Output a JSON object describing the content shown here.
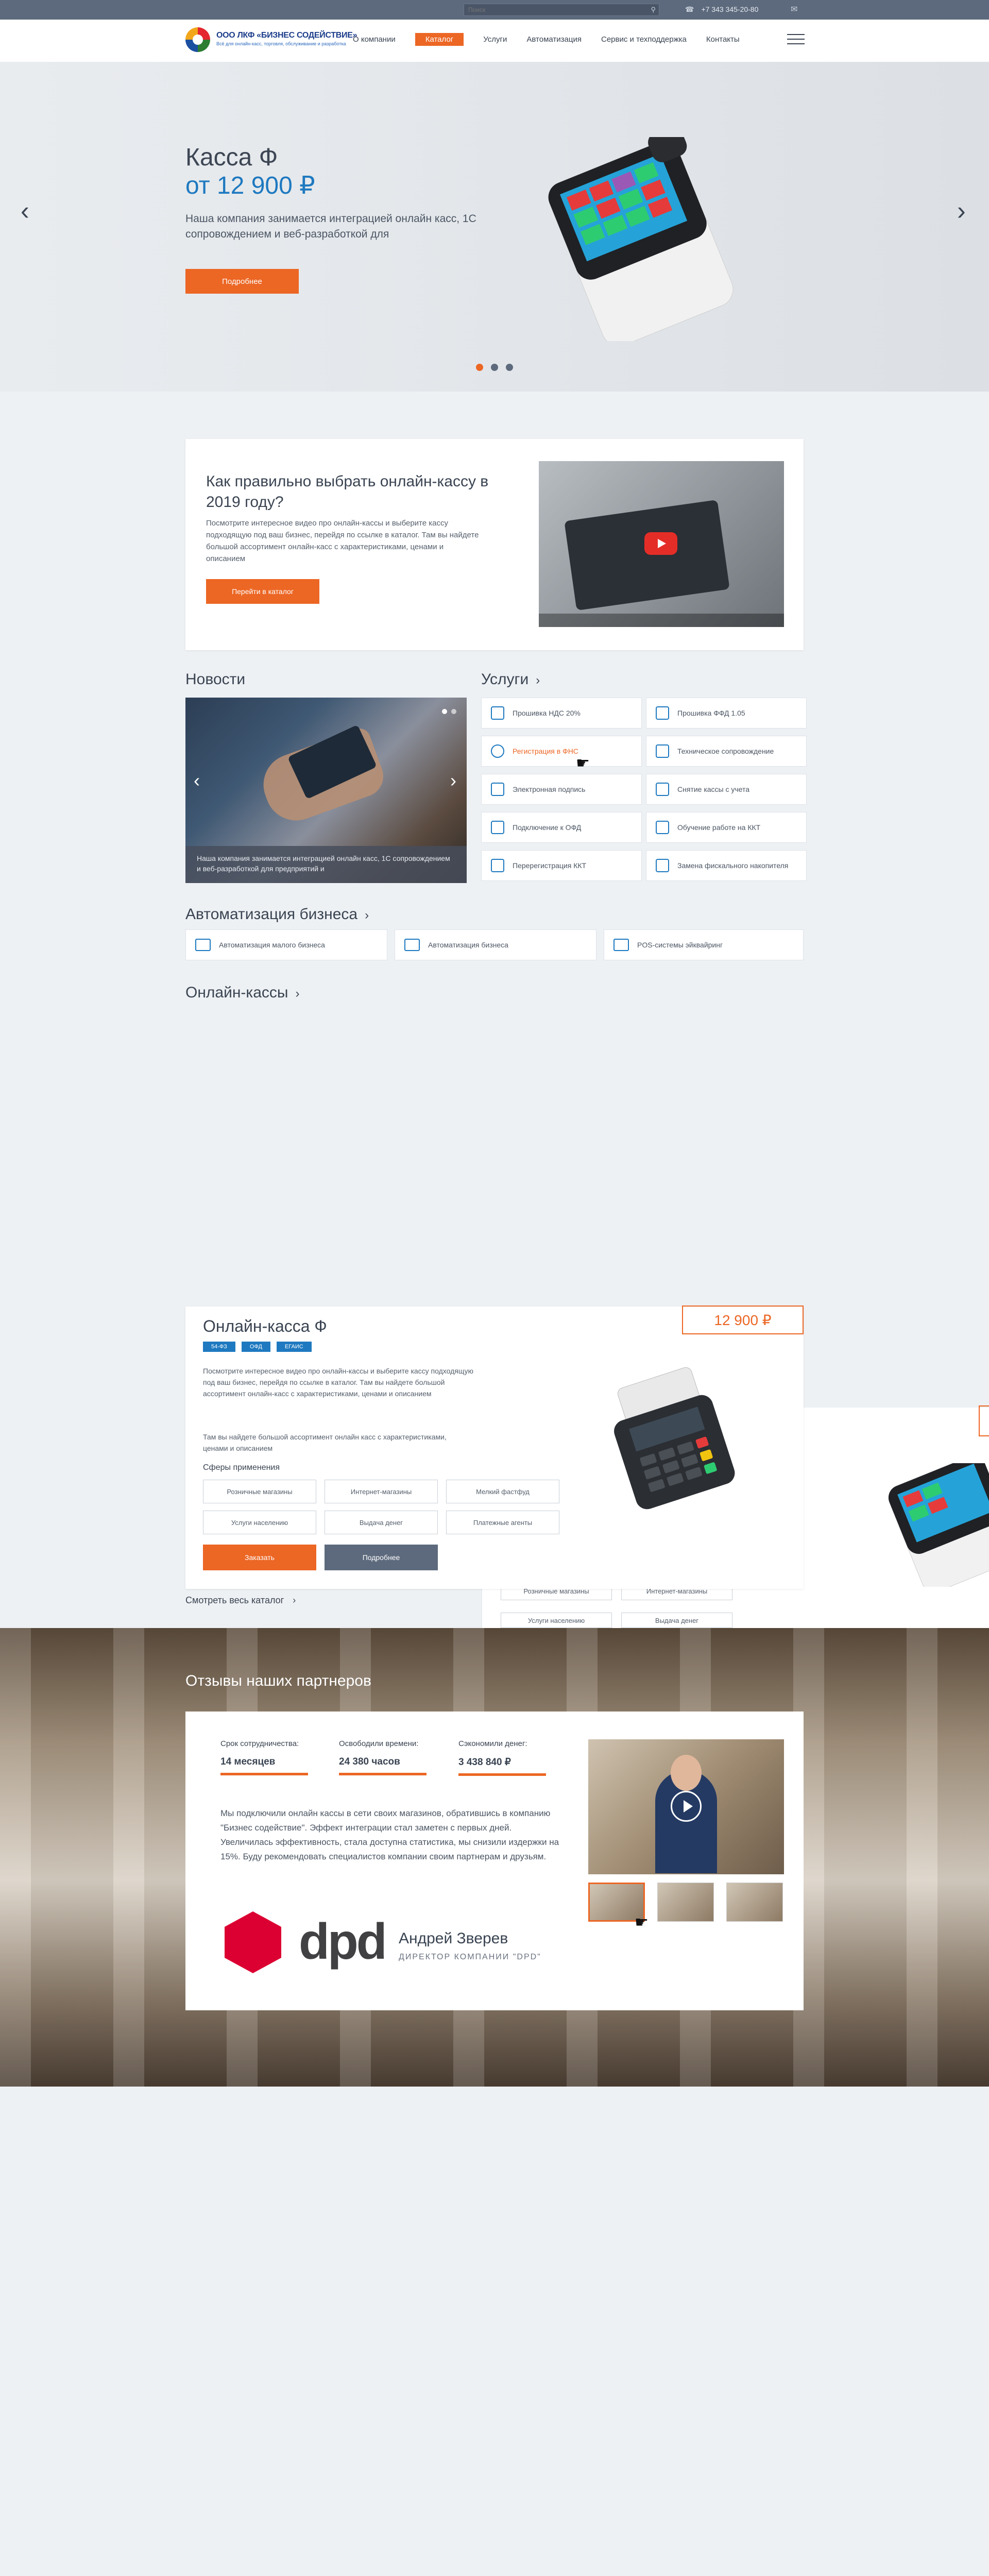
{
  "topbar": {
    "search_placeholder": "Поиск",
    "phone": "+7 343 345-20-80"
  },
  "header": {
    "logo_title": "ООО ЛКФ «БИЗНЕС СОДЕЙСТВИЕ»",
    "logo_sub": "Всё для онлайн-касс, торговля, обслуживание и разработка",
    "nav": [
      "О компании",
      "Каталог",
      "Услуги",
      "Автоматизация",
      "Сервис и техподдержка",
      "Контакты"
    ]
  },
  "hero": {
    "title": "Касса Ф",
    "price": "от 12 900 ₽",
    "desc": "Наша компания занимается интеграцией онлайн касс, 1С сопровождением и веб-разработкой для",
    "button": "Подробнее"
  },
  "promo": {
    "title": "Как правильно выбрать онлайн-кассу в 2019 году?",
    "desc": "Посмотрите интересное видео про онлайн-кассы и выберите кассу подходящую под ваш бизнес, перейдя по ссылке в каталог. Там вы найдете большой ассортимент онлайн-касс с характеристиками, ценами и описанием",
    "button": "Перейти в каталог"
  },
  "news": {
    "heading": "Новости",
    "caption": "Наша компания занимается интеграцией онлайн касс, 1С сопровождением и веб-разработкой для предприятий и"
  },
  "services": {
    "heading": "Услуги",
    "items": [
      "Прошивка НДС 20%",
      "Прошивка ФФД 1.05",
      "Регистрация в ФНС",
      "Техническое сопровождение",
      "Электронная подпись",
      "Снятие кассы с учета",
      "Подключение к ОФД",
      "Обучение работе на ККТ",
      "Перерегистрация ККТ",
      "Замена фискального накопителя"
    ]
  },
  "automation": {
    "heading": "Автоматизация бизнеса",
    "items": [
      "Автоматизация малого бизнеса",
      "Автоматизация бизнеса",
      "POS-системы эйквайринг"
    ]
  },
  "online_kassy": {
    "heading": "Онлайн-кассы"
  },
  "product": {
    "title": "Онлайн-касса Ф",
    "price": "12 900 ₽",
    "tags": [
      "54-ФЗ",
      "ОФД",
      "ЕГАИС"
    ],
    "desc": "Посмотрите интересное видео про онлайн-кассы и выберите кассу подходящую под ваш бизнес, перейдя по ссылке в каталог. Там вы найдете большой ассортимент онлайн-касс с характеристиками, ценами и описанием",
    "desc2": "Там вы найдете большой ассортимент онлайн касс с характеристиками, ценами и описанием",
    "spheres_label": "Сферы применения",
    "spheres": [
      "Розничные магазины",
      "Интернет-магазины",
      "Мелкий фастфуд",
      "Услуги населению",
      "Выдача денег",
      "Платежные агенты"
    ],
    "order_button": "Заказать",
    "more_button": "Подробнее",
    "back_chips": [
      "Розничные магазины",
      "Интернет-магазины",
      "Услуги населению",
      "Выдача денег"
    ]
  },
  "see_all": "Смотреть весь каталог",
  "reviews": {
    "heading": "Отзывы наших партнеров",
    "stats": [
      {
        "label": "Срок сотрудничества:",
        "value": "14 месяцев"
      },
      {
        "label": "Освободили времени:",
        "value": "24 380 часов"
      },
      {
        "label": "Сэкономили денег:",
        "value": "3 438 840 ₽"
      }
    ],
    "text": "Мы подключили онлайн кассы в сети своих магазинов, обратившись в компанию \"Бизнес содействие\". Эффект интеграции стал заметен с первых дней. Увеличилась эффективность, стала доступна статистика, мы снизили издержки на 15%. Буду рекомендовать специалистов компании своим партнерам и друзьям.",
    "brand": "dpd",
    "person": "Андрей Зверев",
    "role": "ДИРЕКТОР КОМПАНИИ \"DPD\""
  }
}
